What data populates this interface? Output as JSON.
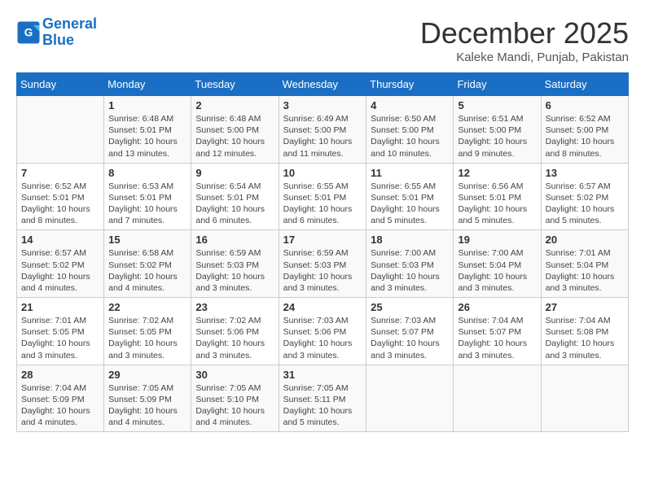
{
  "header": {
    "logo_line1": "General",
    "logo_line2": "Blue",
    "month_title": "December 2025",
    "subtitle": "Kaleke Mandi, Punjab, Pakistan"
  },
  "calendar": {
    "days_of_week": [
      "Sunday",
      "Monday",
      "Tuesday",
      "Wednesday",
      "Thursday",
      "Friday",
      "Saturday"
    ],
    "weeks": [
      [
        {
          "day": "",
          "info": ""
        },
        {
          "day": "1",
          "info": "Sunrise: 6:48 AM\nSunset: 5:01 PM\nDaylight: 10 hours\nand 13 minutes."
        },
        {
          "day": "2",
          "info": "Sunrise: 6:48 AM\nSunset: 5:00 PM\nDaylight: 10 hours\nand 12 minutes."
        },
        {
          "day": "3",
          "info": "Sunrise: 6:49 AM\nSunset: 5:00 PM\nDaylight: 10 hours\nand 11 minutes."
        },
        {
          "day": "4",
          "info": "Sunrise: 6:50 AM\nSunset: 5:00 PM\nDaylight: 10 hours\nand 10 minutes."
        },
        {
          "day": "5",
          "info": "Sunrise: 6:51 AM\nSunset: 5:00 PM\nDaylight: 10 hours\nand 9 minutes."
        },
        {
          "day": "6",
          "info": "Sunrise: 6:52 AM\nSunset: 5:00 PM\nDaylight: 10 hours\nand 8 minutes."
        }
      ],
      [
        {
          "day": "7",
          "info": "Sunrise: 6:52 AM\nSunset: 5:01 PM\nDaylight: 10 hours\nand 8 minutes."
        },
        {
          "day": "8",
          "info": "Sunrise: 6:53 AM\nSunset: 5:01 PM\nDaylight: 10 hours\nand 7 minutes."
        },
        {
          "day": "9",
          "info": "Sunrise: 6:54 AM\nSunset: 5:01 PM\nDaylight: 10 hours\nand 6 minutes."
        },
        {
          "day": "10",
          "info": "Sunrise: 6:55 AM\nSunset: 5:01 PM\nDaylight: 10 hours\nand 6 minutes."
        },
        {
          "day": "11",
          "info": "Sunrise: 6:55 AM\nSunset: 5:01 PM\nDaylight: 10 hours\nand 5 minutes."
        },
        {
          "day": "12",
          "info": "Sunrise: 6:56 AM\nSunset: 5:01 PM\nDaylight: 10 hours\nand 5 minutes."
        },
        {
          "day": "13",
          "info": "Sunrise: 6:57 AM\nSunset: 5:02 PM\nDaylight: 10 hours\nand 5 minutes."
        }
      ],
      [
        {
          "day": "14",
          "info": "Sunrise: 6:57 AM\nSunset: 5:02 PM\nDaylight: 10 hours\nand 4 minutes."
        },
        {
          "day": "15",
          "info": "Sunrise: 6:58 AM\nSunset: 5:02 PM\nDaylight: 10 hours\nand 4 minutes."
        },
        {
          "day": "16",
          "info": "Sunrise: 6:59 AM\nSunset: 5:03 PM\nDaylight: 10 hours\nand 3 minutes."
        },
        {
          "day": "17",
          "info": "Sunrise: 6:59 AM\nSunset: 5:03 PM\nDaylight: 10 hours\nand 3 minutes."
        },
        {
          "day": "18",
          "info": "Sunrise: 7:00 AM\nSunset: 5:03 PM\nDaylight: 10 hours\nand 3 minutes."
        },
        {
          "day": "19",
          "info": "Sunrise: 7:00 AM\nSunset: 5:04 PM\nDaylight: 10 hours\nand 3 minutes."
        },
        {
          "day": "20",
          "info": "Sunrise: 7:01 AM\nSunset: 5:04 PM\nDaylight: 10 hours\nand 3 minutes."
        }
      ],
      [
        {
          "day": "21",
          "info": "Sunrise: 7:01 AM\nSunset: 5:05 PM\nDaylight: 10 hours\nand 3 minutes."
        },
        {
          "day": "22",
          "info": "Sunrise: 7:02 AM\nSunset: 5:05 PM\nDaylight: 10 hours\nand 3 minutes."
        },
        {
          "day": "23",
          "info": "Sunrise: 7:02 AM\nSunset: 5:06 PM\nDaylight: 10 hours\nand 3 minutes."
        },
        {
          "day": "24",
          "info": "Sunrise: 7:03 AM\nSunset: 5:06 PM\nDaylight: 10 hours\nand 3 minutes."
        },
        {
          "day": "25",
          "info": "Sunrise: 7:03 AM\nSunset: 5:07 PM\nDaylight: 10 hours\nand 3 minutes."
        },
        {
          "day": "26",
          "info": "Sunrise: 7:04 AM\nSunset: 5:07 PM\nDaylight: 10 hours\nand 3 minutes."
        },
        {
          "day": "27",
          "info": "Sunrise: 7:04 AM\nSunset: 5:08 PM\nDaylight: 10 hours\nand 3 minutes."
        }
      ],
      [
        {
          "day": "28",
          "info": "Sunrise: 7:04 AM\nSunset: 5:09 PM\nDaylight: 10 hours\nand 4 minutes."
        },
        {
          "day": "29",
          "info": "Sunrise: 7:05 AM\nSunset: 5:09 PM\nDaylight: 10 hours\nand 4 minutes."
        },
        {
          "day": "30",
          "info": "Sunrise: 7:05 AM\nSunset: 5:10 PM\nDaylight: 10 hours\nand 4 minutes."
        },
        {
          "day": "31",
          "info": "Sunrise: 7:05 AM\nSunset: 5:11 PM\nDaylight: 10 hours\nand 5 minutes."
        },
        {
          "day": "",
          "info": ""
        },
        {
          "day": "",
          "info": ""
        },
        {
          "day": "",
          "info": ""
        }
      ]
    ]
  }
}
